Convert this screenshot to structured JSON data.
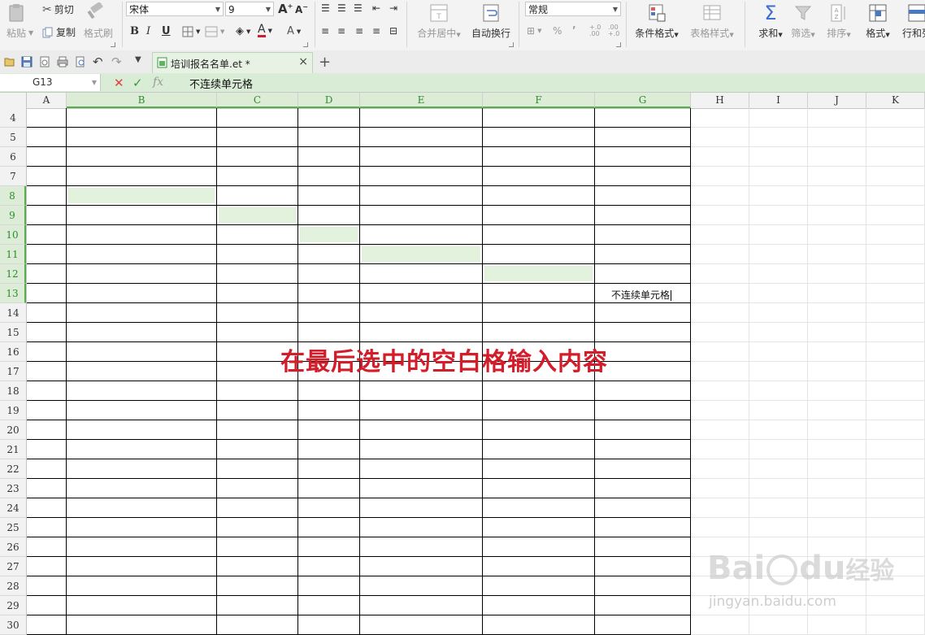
{
  "ribbon": {
    "paste": "粘贴",
    "cut": "剪切",
    "copy": "复制",
    "format_painter": "格式刷",
    "font_name": "宋体",
    "font_size": "9",
    "bold": "B",
    "italic": "I",
    "underline": "U",
    "merge_center": "合并居中",
    "wrap_text": "自动换行",
    "number_format": "常规",
    "percent": "%",
    "comma": "’",
    "inc_decimal": "+.0\n.00",
    "dec_decimal": ".00\n+.0",
    "cond_format": "条件格式",
    "table_style": "表格样式",
    "sum": "求和",
    "filter": "筛选",
    "sort": "排序",
    "format": "格式",
    "rowcol": "行和列"
  },
  "tabs": {
    "doc_title": "培训报名名单.et *"
  },
  "formula_bar": {
    "cell_ref": "G13",
    "fx": "fx",
    "content": "不连续单元格"
  },
  "columns": [
    "A",
    "B",
    "C",
    "D",
    "E",
    "F",
    "G",
    "H",
    "I",
    "J",
    "K"
  ],
  "selected_columns": [
    "B",
    "C",
    "D",
    "E",
    "F",
    "G"
  ],
  "rows": [
    "4",
    "5",
    "6",
    "7",
    "8",
    "9",
    "10",
    "11",
    "12",
    "13",
    "14",
    "15",
    "16",
    "17",
    "18",
    "19",
    "20",
    "21",
    "22",
    "23",
    "24",
    "25",
    "26",
    "27",
    "28",
    "29",
    "30"
  ],
  "selected_rows": [
    "8",
    "9",
    "10",
    "11",
    "12",
    "13"
  ],
  "cells": {
    "G13": "不连续单元格"
  },
  "annotation": "在最后选中的空白格输入内容",
  "watermark": {
    "brand": "Bai",
    "brand2": "du",
    "brand_cn": "经验",
    "url": "jingyan.baidu.com"
  },
  "colors": {
    "selection_fill": "#e3f2dd",
    "header_selected": "#dcecd7",
    "annotation_red": "#d21e2a",
    "formula_bar_bg": "#d9ecd5"
  }
}
